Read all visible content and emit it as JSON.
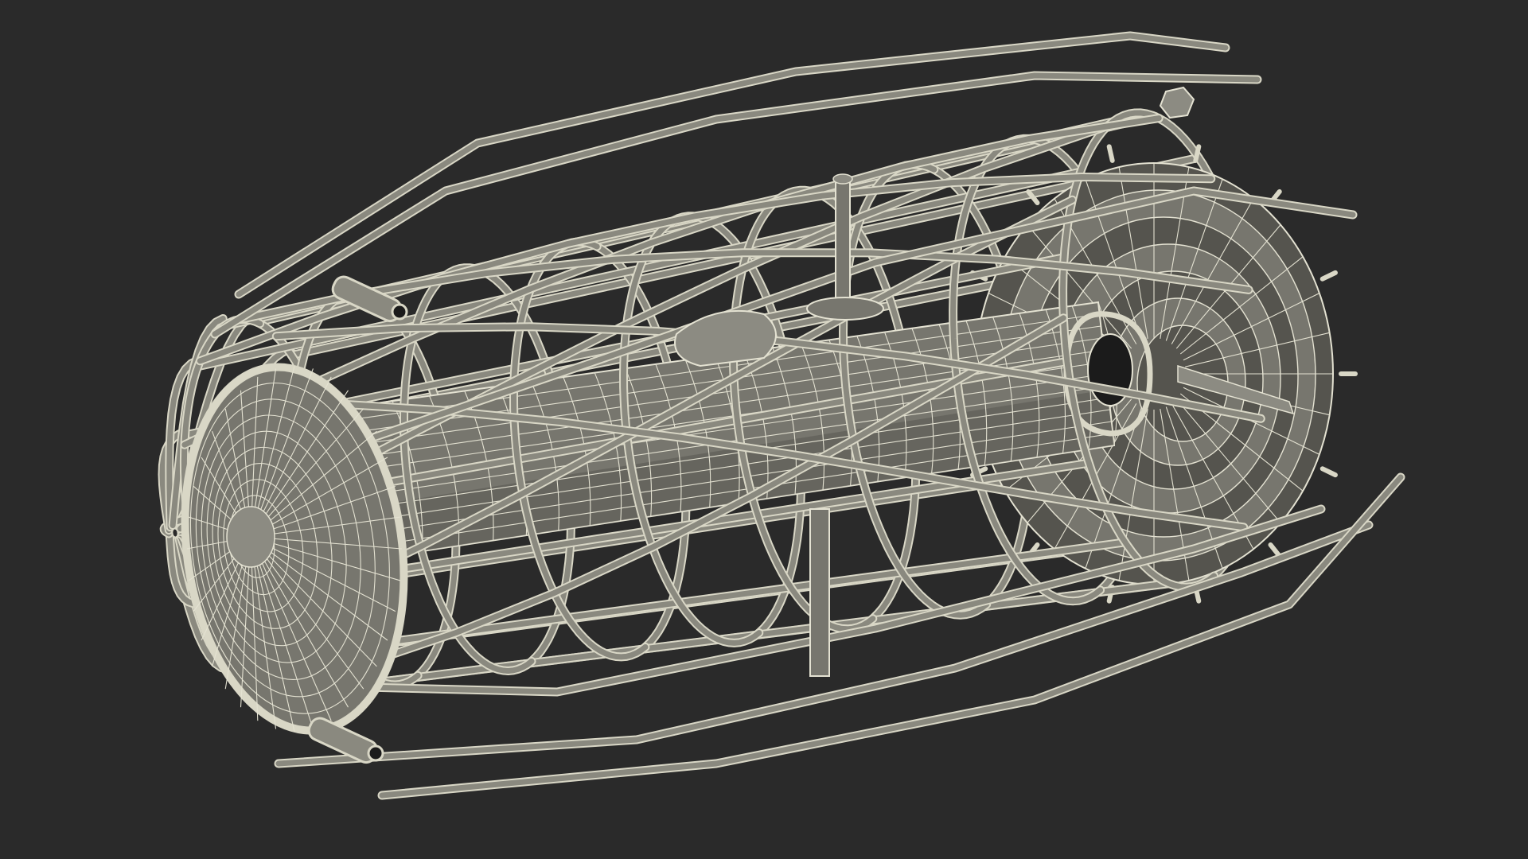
{
  "scene": {
    "subject": "wireframe-cage-buoy",
    "background_color": "#2a2a2a",
    "surface_color": "#77766e",
    "surface_dark_color": "#55544e",
    "surface_light_color": "#8c8b82",
    "wire_color": "#e4e2d2",
    "cage_color": "#8a897f",
    "cage_edge_color": "#d9d7c6",
    "hole_color": "#1b1b1b"
  }
}
